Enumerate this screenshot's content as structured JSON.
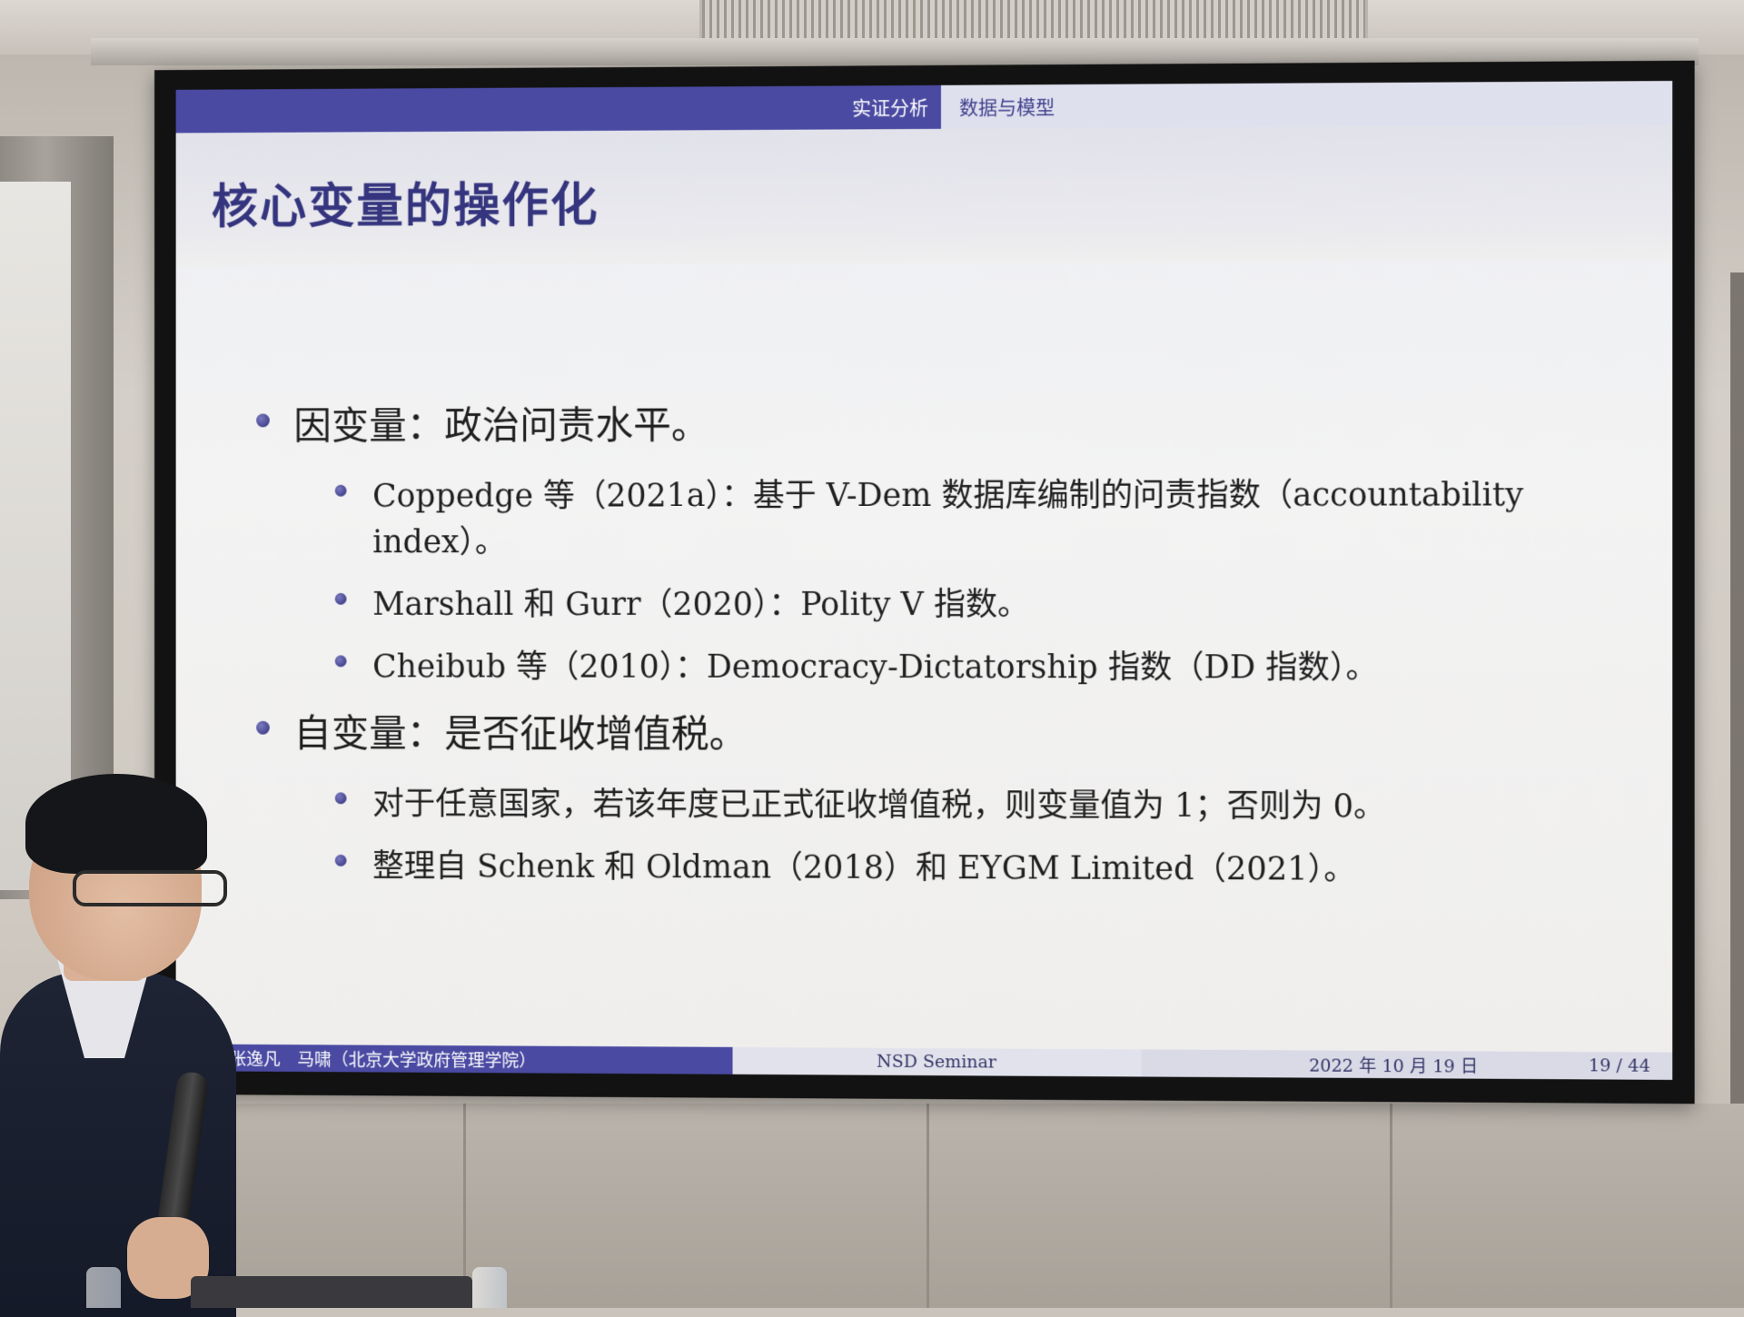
{
  "slide": {
    "nav_section": "实证分析",
    "nav_subsection": "数据与模型",
    "title": "核心变量的操作化",
    "items": [
      {
        "text": "因变量：政治问责水平。",
        "subitems": [
          "Coppedge 等（2021a）：基于 V-Dem 数据库编制的问责指数（accountability index）。",
          "Marshall 和 Gurr（2020）：Polity V 指数。",
          "Cheibub 等（2010）：Democracy-Dictatorship 指数（DD 指数）。"
        ]
      },
      {
        "text": "自变量：是否征收增值税。",
        "subitems": [
          "对于任意国家，若该年度已正式征收增值税，则变量值为 1；否则为 0。",
          "整理自 Schenk 和 Oldman（2018）和 EYGM Limited（2021）。"
        ]
      }
    ],
    "footer": {
      "authors": "张逸凡　马啸（北京大学政府管理学院）",
      "event": "NSD Seminar",
      "date": "2022 年 10 月 19 日",
      "page": "19 / 44"
    }
  },
  "colors": {
    "theme_blue": "#4a4aa3",
    "title_color": "#35357f"
  }
}
